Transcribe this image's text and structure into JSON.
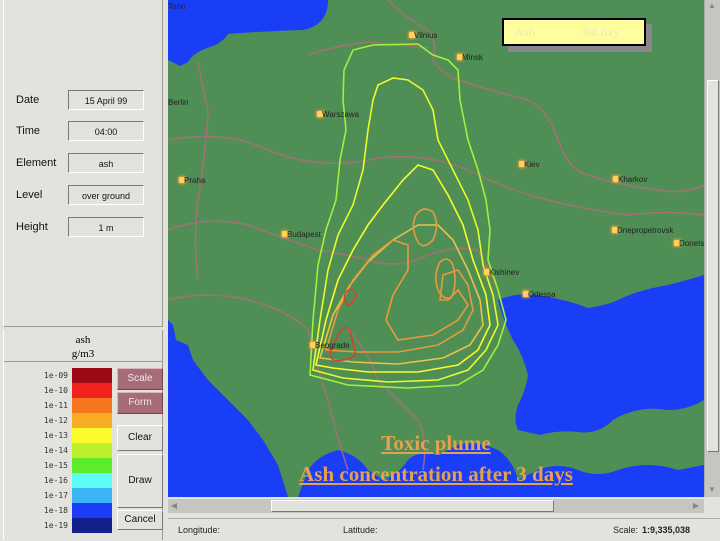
{
  "info": {
    "fields": [
      {
        "label": "Date",
        "value": "15 April 99"
      },
      {
        "label": "Time",
        "value": "04:00"
      },
      {
        "label": "Element",
        "value": "ash"
      },
      {
        "label": "Level",
        "value": "over ground"
      },
      {
        "label": "Height",
        "value": "1 m"
      }
    ]
  },
  "legend": {
    "element": "ash",
    "unit": "g/m3",
    "scale": [
      {
        "label": "1e-09",
        "color": "#9c0a16"
      },
      {
        "label": "1e-10",
        "color": "#f0241c"
      },
      {
        "label": "1e-11",
        "color": "#f4761e"
      },
      {
        "label": "1e-12",
        "color": "#f8ac24"
      },
      {
        "label": "1e-13",
        "color": "#fcfc2c"
      },
      {
        "label": "1e-14",
        "color": "#bcf02a"
      },
      {
        "label": "1e-15",
        "color": "#5cec2c"
      },
      {
        "label": "1e-16",
        "color": "#5cfcf4"
      },
      {
        "label": "1e-17",
        "color": "#3cb4f4"
      },
      {
        "label": "1e-18",
        "color": "#1c3cf8"
      },
      {
        "label": "1e-19",
        "color": "#14208c"
      }
    ]
  },
  "buttons": {
    "scale": "Scale",
    "form": "Form",
    "clear": "Clear",
    "draw": "Draw",
    "cancel": "Cancel"
  },
  "map": {
    "label_element": "Ash",
    "label_day": "3rd day",
    "caption_line1": "Toxic plume",
    "caption_line2": "Ash concentration after 3 days",
    "cities": [
      {
        "name": "Tonn"
      },
      {
        "name": "Berlin"
      },
      {
        "name": "Vilnius"
      },
      {
        "name": "Minsk"
      },
      {
        "name": "Warszawa"
      },
      {
        "name": "Praha"
      },
      {
        "name": "Kiev"
      },
      {
        "name": "Kharkov"
      },
      {
        "name": "Dnepropetrovsk"
      },
      {
        "name": "Donetsk"
      },
      {
        "name": "Budapest"
      },
      {
        "name": "Kishinev"
      },
      {
        "name": "Odessa"
      },
      {
        "name": "Beograde"
      }
    ]
  },
  "status": {
    "longitude_label": "Longitude:",
    "latitude_label": "Latitude:",
    "scale_label": "Scale:",
    "scale_value": "1:9,335,038"
  }
}
